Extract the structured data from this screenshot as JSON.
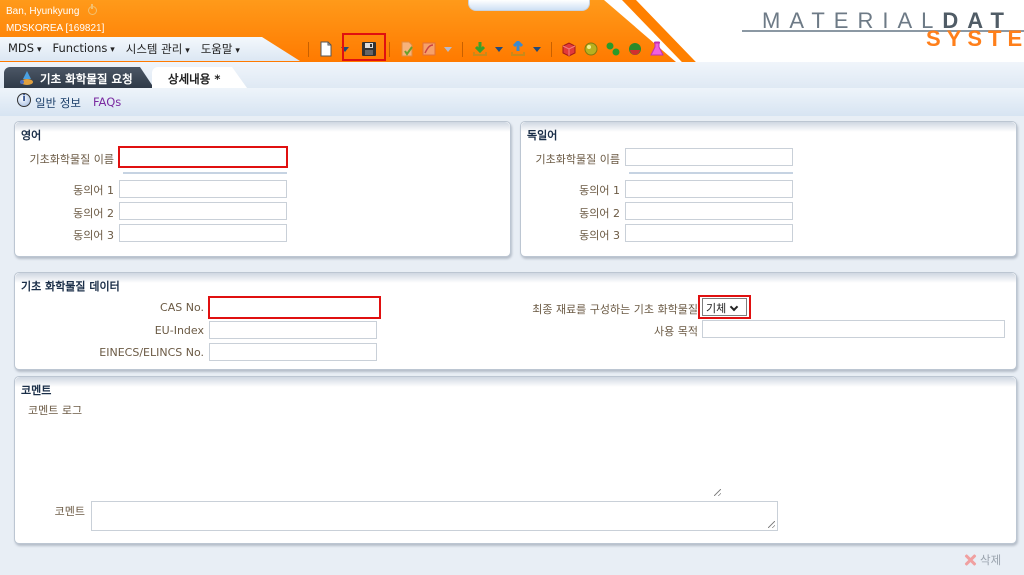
{
  "header": {
    "user_name": "Ban, Hyunkyung",
    "org": "MDSKOREA [169821]",
    "logo_line1_light": "MATERIAL",
    "logo_line1_bold": "DAT",
    "logo_line2": "SYSTE"
  },
  "menu": {
    "items": [
      {
        "label": "MDS"
      },
      {
        "label": "Functions"
      },
      {
        "label": "시스템 관리"
      },
      {
        "label": "도움말"
      }
    ]
  },
  "toolbar": {
    "icons": [
      "new-document-icon",
      "save-icon",
      "accept-icon",
      "pdf-export-icon",
      "download-icon",
      "upload-icon",
      "material-icon",
      "substance-icon",
      "basic-substance-icon",
      "recycle-icon",
      "chemistry-flask-icon"
    ],
    "highlighted": "save-icon"
  },
  "tabs": [
    {
      "label": "기초 화학물질 요청",
      "active": false
    },
    {
      "label": "상세내용 *",
      "active": true
    }
  ],
  "infobar": {
    "general_info": "일반 정보",
    "faqs": "FAQs"
  },
  "english_panel": {
    "title": "영어",
    "name_label": "기초화학물질 이름",
    "name_value": "",
    "synonyms": [
      {
        "label": "동의어 1",
        "value": ""
      },
      {
        "label": "동의어 2",
        "value": ""
      },
      {
        "label": "동의어 3",
        "value": ""
      }
    ]
  },
  "german_panel": {
    "title": "독일어",
    "name_label": "기초화학물질 이름",
    "name_value": "",
    "synonyms": [
      {
        "label": "동의어 1",
        "value": ""
      },
      {
        "label": "동의어 2",
        "value": ""
      },
      {
        "label": "동의어 3",
        "value": ""
      }
    ]
  },
  "data_panel": {
    "title": "기초 화학물질 데이터",
    "cas_label": "CAS No.",
    "cas_value": "",
    "eu_index_label": "EU-Index",
    "eu_index_value": "",
    "einecs_label": "EINECS/ELINCS No.",
    "einecs_value": "",
    "state_label": "최종 재료를 구성하는 기초 화학물질",
    "state_value": "기체",
    "usage_label": "사용 목적",
    "usage_value": ""
  },
  "comment_panel": {
    "title": "코멘트",
    "log_label": "코멘트 로그",
    "comment_label": "코멘트",
    "comment_value": ""
  },
  "footer": {
    "delete_label": "삭제"
  },
  "colors": {
    "header_orange": "#ff7a00",
    "highlight_red": "#e01010",
    "logo_orange": "#ff7f1a"
  }
}
